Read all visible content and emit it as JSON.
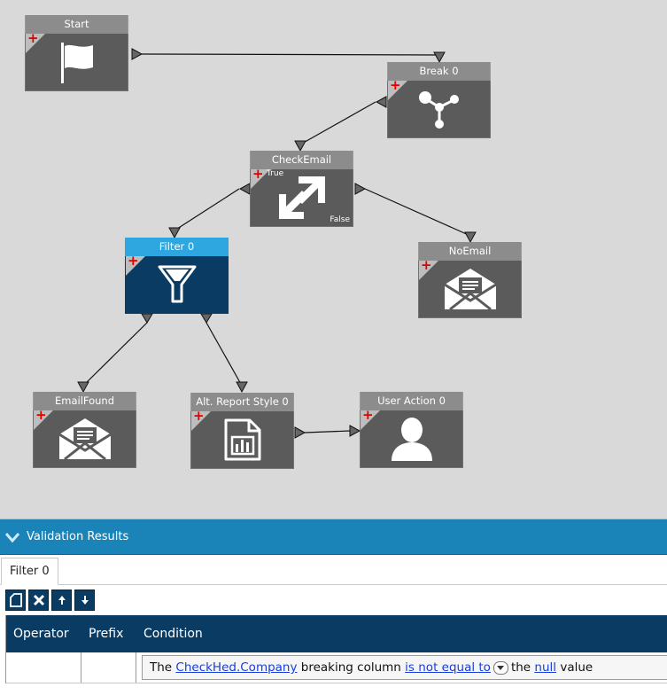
{
  "nodes": {
    "start": {
      "title": "Start",
      "icon": "flag-icon"
    },
    "break0": {
      "title": "Break 0",
      "icon": "break-nodes-icon"
    },
    "checkemail": {
      "title": "CheckEmail",
      "true_label": "True",
      "false_label": "False",
      "icon": "condition-arrows-icon"
    },
    "filter0": {
      "title": "Filter 0",
      "icon": "filter-funnel-icon"
    },
    "noemail": {
      "title": "NoEmail",
      "icon": "email-icon"
    },
    "emailfound": {
      "title": "EmailFound",
      "icon": "email-icon"
    },
    "altreport": {
      "title": "Alt. Report Style 0",
      "icon": "report-chart-icon"
    },
    "useraction": {
      "title": "User Action 0",
      "icon": "user-icon"
    }
  },
  "panel": {
    "title": "Validation Results",
    "tab": "Filter 0",
    "toolbar": [
      "new-icon",
      "delete-icon",
      "arrow-up-icon",
      "arrow-down-icon"
    ],
    "columns": {
      "operator": "Operator",
      "prefix": "Prefix",
      "condition": "Condition"
    },
    "row": {
      "operator": "",
      "prefix": "",
      "cond_the": "The",
      "cond_column": "CheckHed.Company",
      "cond_breaking": "breaking column",
      "cond_operator": "is not equal to",
      "cond_the2": "the",
      "cond_value": "null",
      "cond_value_suffix": "value"
    }
  },
  "colors": {
    "canvas": "#d9d9d9",
    "node_header": "#8c8c8c",
    "node_body": "#5b5b5b",
    "selected_header": "#2ea7e0",
    "selected_body": "#0a3c63",
    "panel_header": "#1a84b8",
    "grid_header": "#0a3c63",
    "link": "#1a3ed8"
  }
}
